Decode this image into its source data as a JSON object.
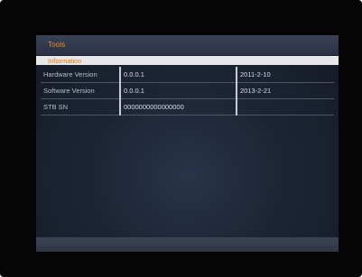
{
  "menu": {
    "title": "Tools",
    "section": "Information"
  },
  "info": {
    "rows": [
      {
        "label": "Hardware Version",
        "value": "0.0.0.1",
        "date": "2011-2-10"
      },
      {
        "label": "Software Version",
        "value": "0.0.0.1",
        "date": "2013-2-21"
      },
      {
        "label": "STB SN",
        "value": "0000000000000000",
        "date": ""
      }
    ]
  },
  "colors": {
    "accent": "#e8901f",
    "panel_bg": "#1d2535",
    "section_bg": "#e7e7e9"
  }
}
